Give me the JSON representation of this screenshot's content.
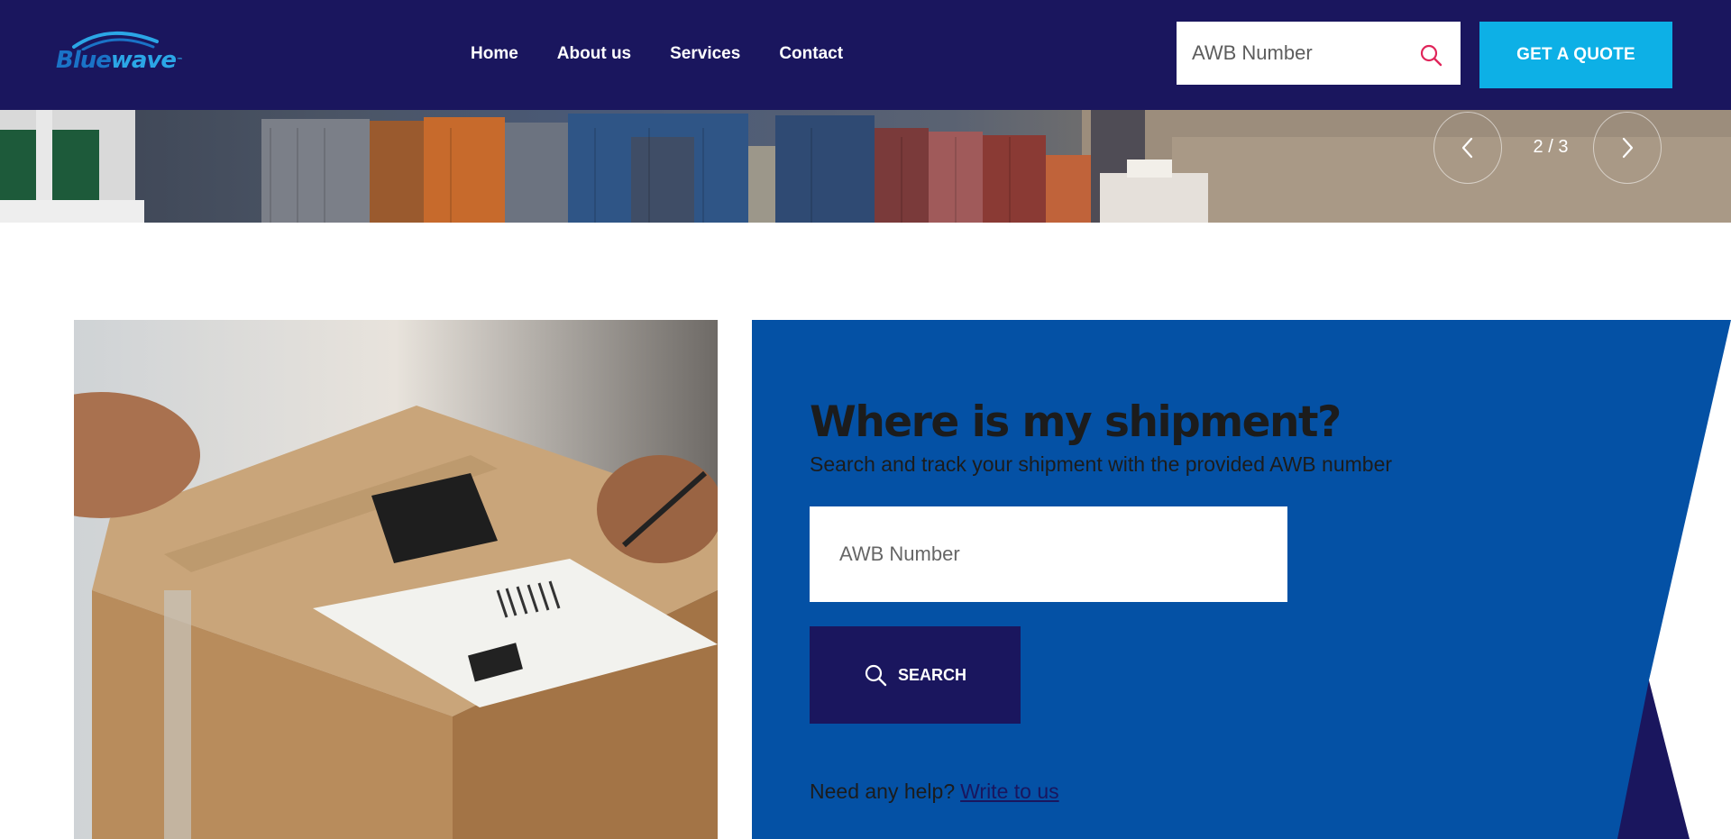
{
  "brand": {
    "logo_part1": "Blue",
    "logo_part2": "wave",
    "logo_tm": "™",
    "colors": {
      "navy": "#1a165e",
      "cyan": "#0db0e6",
      "blue": "#0451a5"
    }
  },
  "nav": {
    "items": [
      {
        "label": "Home"
      },
      {
        "label": "About us"
      },
      {
        "label": "Services"
      },
      {
        "label": "Contact"
      }
    ]
  },
  "header_search": {
    "placeholder": "AWB Number",
    "icon": "search-icon"
  },
  "quote_button": {
    "label": "GET A QUOTE"
  },
  "slider": {
    "counter": "2 / 3",
    "prev_icon": "chevron-left-icon",
    "next_icon": "chevron-right-icon"
  },
  "tracking": {
    "title": "Where is my shipment?",
    "subtitle": "Search and track your shipment with the provided AWB number",
    "input_placeholder": "AWB Number",
    "search_label": "SEARCH",
    "help_text": "Need any help?",
    "help_link": "Write to us"
  }
}
